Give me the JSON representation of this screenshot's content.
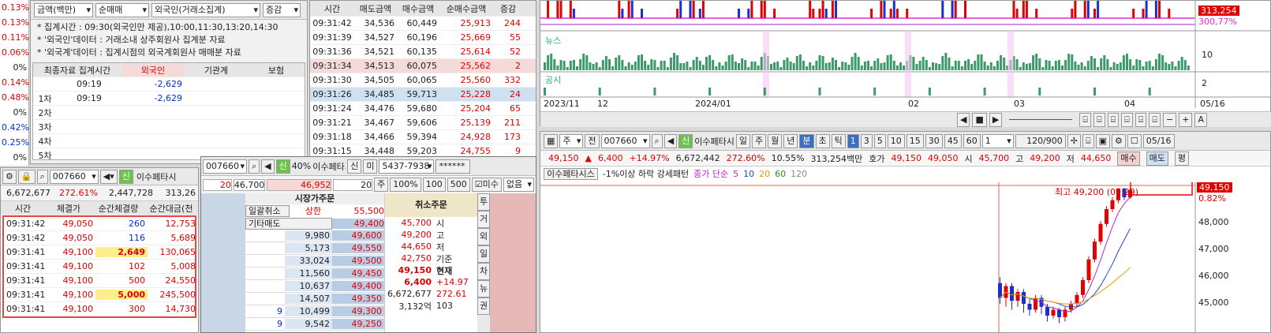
{
  "left_axis": {
    "labels": [
      "0.13%",
      "0.13%",
      "0.11%",
      "0.06%",
      "0%",
      "0.14%",
      "0.48%",
      "0%",
      "0.42%",
      "0.25%",
      "0%"
    ]
  },
  "investor": {
    "toolbar": [
      "금액(백만)",
      "순매매",
      "외국인(거래소집계)",
      "증감"
    ],
    "notes": [
      "* 집계시간 : 09:30(외국인만 제공),10:00,11:30,13:20,14:30",
      "* '외국인'데이터 : 거래소내 상주회원사 집계분 자료",
      "* '외국계'데이터 : 집계시점의 외국계회원사 매매분 자료"
    ],
    "headers": [
      "최종자료 집계시간",
      "외국인",
      "기관계",
      "보험"
    ],
    "rows": [
      {
        "label": "",
        "time": "09:19",
        "val": "-2,629"
      },
      {
        "label": "1차",
        "time": "09:19",
        "val": "-2,629"
      },
      {
        "label": "2차",
        "time": "",
        "val": ""
      },
      {
        "label": "3차",
        "time": "",
        "val": ""
      },
      {
        "label": "4차",
        "time": "",
        "val": ""
      },
      {
        "label": "5차",
        "time": "",
        "val": ""
      }
    ]
  },
  "trades_mid": {
    "headers": [
      "시간",
      "매도금액",
      "매수금액",
      "순매수금액",
      "증감"
    ],
    "rows": [
      [
        "09:31:42",
        "34,536",
        "60,449",
        "25,913",
        "244"
      ],
      [
        "09:31:39",
        "34,527",
        "60,196",
        "25,669",
        "55"
      ],
      [
        "09:31:36",
        "34,521",
        "60,135",
        "25,614",
        "52"
      ],
      [
        "09:31:34",
        "34,513",
        "60,075",
        "25,562",
        "2"
      ],
      [
        "09:31:30",
        "34,505",
        "60,065",
        "25,560",
        "332"
      ],
      [
        "09:31:26",
        "34,485",
        "59,713",
        "25,228",
        "24"
      ],
      [
        "09:31:24",
        "34,476",
        "59,680",
        "25,204",
        "65"
      ],
      [
        "09:31:21",
        "34,467",
        "59,606",
        "25,139",
        "211"
      ],
      [
        "09:31:18",
        "34,466",
        "59,394",
        "24,928",
        "173"
      ],
      [
        "09:31:15",
        "34,448",
        "59,203",
        "24,755",
        "9"
      ]
    ]
  },
  "tick_panel": {
    "code": "007660",
    "name": "이수페타시",
    "stats": [
      "6,672,677",
      "272.61%",
      "2,447,728",
      "313,26"
    ],
    "headers": [
      "시간",
      "체결가",
      "순간체결량",
      "순간대금(천"
    ],
    "rows": [
      [
        "09:31:42",
        "49,050",
        "260",
        "12,753"
      ],
      [
        "09:31:42",
        "49,050",
        "116",
        "5,689"
      ],
      [
        "09:31:41",
        "49,100",
        "2,649",
        "130,065"
      ],
      [
        "09:31:41",
        "49,100",
        "102",
        "5,008"
      ],
      [
        "09:31:41",
        "49,100",
        "500",
        "24,550"
      ],
      [
        "09:31:41",
        "49,100",
        "5,000",
        "245,500"
      ],
      [
        "09:31:41",
        "49,100",
        "300",
        "14,730"
      ]
    ]
  },
  "order": {
    "code": "007660",
    "pct": "40%",
    "name": "이수페타시",
    "acct": "5437-7938",
    "pw": "******",
    "qty_small": "20",
    "price": "46,700",
    "amount": "46,952",
    "qty": "20",
    "unit": "주",
    "q100": "100%",
    "q100b": "100",
    "q500": "500",
    "misu": "미수",
    "none": "없음",
    "market_label": "시장가주문",
    "cancel_all": "일괄취소",
    "other_sell": "기타매도",
    "upper": "상한",
    "upper_price": "55,500",
    "cancel_order": "취소주문",
    "ask": [
      [
        "9,980",
        "49,600"
      ],
      [
        "5,173",
        "49,550"
      ],
      [
        "33,024",
        "49,500"
      ],
      [
        "11,560",
        "49,450"
      ],
      [
        "10,637",
        "49,400"
      ],
      [
        "14,507",
        "49,350"
      ],
      [
        "10,499",
        "49,300"
      ],
      [
        "9,542",
        "49,250"
      ]
    ],
    "ask_top": "49,400",
    "bid_extra": [
      "9",
      "9"
    ],
    "info": [
      [
        "45,700",
        "시"
      ],
      [
        "49,200",
        "고"
      ],
      [
        "44,650",
        "저"
      ],
      [
        "42,750",
        "기준"
      ],
      [
        "49,150",
        "현재"
      ],
      [
        "6,400",
        "+14.97"
      ],
      [
        "6,672,677",
        "272.61"
      ],
      [
        "3,132억",
        "103"
      ]
    ],
    "side": [
      "투",
      "거",
      "외",
      "일",
      "차",
      "뉴",
      "권"
    ]
  },
  "top_chart": {
    "price_label": "313,254",
    "pct_label": "300,77%",
    "news_label": "뉴스",
    "notice_label": "공시",
    "ticks_right": [
      "10",
      "2"
    ],
    "dates": [
      "2023/11",
      "12",
      "2024/01",
      "02",
      "03",
      "04",
      "05",
      "05/16"
    ]
  },
  "chart_toolbar": {
    "items": [
      "주",
      "전",
      "007660",
      "신",
      "이수페타시",
      "일",
      "주",
      "월",
      "년",
      "분",
      "초",
      "틱",
      "1",
      "3",
      "5",
      "10",
      "15",
      "30",
      "45",
      "60",
      "1",
      "120/900",
      "05/16"
    ]
  },
  "quote": {
    "price": "49,150",
    "arrow": "▲",
    "change": "6,400",
    "pct": "+14.97%",
    "vol": "6,672,442",
    "volpct": "272.60%",
    "turn": "10.55%",
    "amt": "313,254백만",
    "ho": "호가",
    "bid": "49,150",
    "ask": "49,050",
    "open_l": "시",
    "open": "45,700",
    "high_l": "고",
    "high": "49,200",
    "low_l": "저",
    "low": "44,650",
    "buy": "매수",
    "sell": "매도",
    "avg": "평"
  },
  "price_chart": {
    "title": "이수페타시스",
    "pattern": "-1%이상 하락 강세패턴",
    "ma_label": "종가 단순",
    "ma": [
      "5",
      "10",
      "20",
      "60",
      "120"
    ],
    "high_note": "최고 49,200 (09:29)",
    "y_ticks": [
      "49,150",
      "0.82%",
      "48,000",
      "47,000",
      "46,000",
      "45,000"
    ],
    "candles": [
      [
        46000,
        45500,
        46200,
        45300
      ],
      [
        45500,
        45900,
        46000,
        45200
      ],
      [
        45900,
        45400,
        46000,
        45100
      ],
      [
        45400,
        45700,
        45800,
        45200
      ],
      [
        45700,
        45300,
        45800,
        45000
      ],
      [
        45300,
        45100,
        45500,
        44900
      ],
      [
        45100,
        45500,
        45600,
        45000
      ],
      [
        45500,
        45200,
        45600,
        44950
      ],
      [
        45200,
        44900,
        45300,
        44700
      ],
      [
        44900,
        45100,
        45200,
        44800
      ],
      [
        45100,
        44850,
        45150,
        44650
      ],
      [
        44850,
        45100,
        45200,
        44700
      ],
      [
        45100,
        45300,
        45400,
        45000
      ],
      [
        45300,
        45600,
        45700,
        45200
      ],
      [
        45600,
        46100,
        46200,
        45500
      ],
      [
        46100,
        46800,
        46900,
        46000
      ],
      [
        46800,
        47400,
        47500,
        46700
      ],
      [
        47400,
        48000,
        48100,
        47300
      ],
      [
        48000,
        48500,
        48600,
        47900
      ],
      [
        48500,
        48800,
        48900,
        48400
      ],
      [
        48800,
        49200,
        49200,
        48700
      ],
      [
        49200,
        48900,
        49200,
        48800
      ],
      [
        48900,
        49150,
        49200,
        48850
      ]
    ]
  }
}
